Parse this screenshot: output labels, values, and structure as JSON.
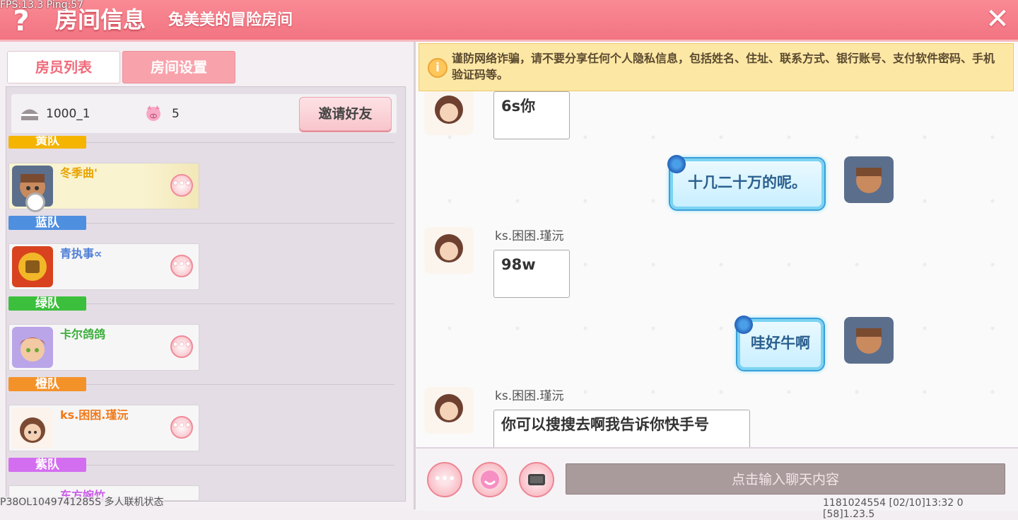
{
  "overlay": {
    "fps": "FPS:13.3  Ping:57"
  },
  "header": {
    "title": "房间信息",
    "subtitle": "兔美美的冒险房间",
    "help_glyph": "?",
    "close_glyph": "✕"
  },
  "tabs": [
    {
      "label": "房员列表",
      "active": true
    },
    {
      "label": "房间设置",
      "active": false
    }
  ],
  "room": {
    "room_id": "1000_1",
    "member_count": "5",
    "invite_label": "邀请好友"
  },
  "teams": [
    {
      "name": "黄队",
      "color": "#f4b400",
      "members": [
        {
          "name": "冬季曲'",
          "color": "#e8a300"
        }
      ]
    },
    {
      "name": "蓝队",
      "color": "#4f8fe0",
      "members": [
        {
          "name": "青执事∝",
          "color": "#4f7fd6"
        }
      ]
    },
    {
      "name": "绿队",
      "color": "#3cbf3c",
      "members": [
        {
          "name": "卡尔鸽鸽",
          "color": "#3cae3c"
        }
      ]
    },
    {
      "name": "橙队",
      "color": "#f4922a",
      "members": [
        {
          "name": "ks.困困.瑾沅",
          "color": "#f07a1a"
        }
      ]
    },
    {
      "name": "紫队",
      "color": "#d46ef0",
      "members": [
        {
          "name": "东方婉竹",
          "color": "#c95de8"
        }
      ]
    }
  ],
  "more_glyph": "•••",
  "notice": {
    "icon": "i",
    "text": "谨防网络诈骗，请不要分享任何个人隐私信息，包括姓名、住址、联系方式、银行账号、支付软件密码、手机验证码等。"
  },
  "messages": [
    {
      "side": "left",
      "sender": "",
      "text": "6s你"
    },
    {
      "side": "right",
      "sender": "",
      "text": "十几二十万的呢。"
    },
    {
      "side": "left",
      "sender": "ks.困困.瑾沅",
      "text": "98w"
    },
    {
      "side": "right",
      "sender": "",
      "text": "哇好牛啊"
    },
    {
      "side": "left",
      "sender": "ks.困困.瑾沅",
      "text": "你可以搜搜去啊我告诉你快手号"
    }
  ],
  "input": {
    "placeholder": "点击输入聊天内容"
  },
  "footer": {
    "left": "P38OL1049741285S 多人联机状态",
    "right": "1181024554   [02/10]13:32 0   [58]1.23.5"
  }
}
